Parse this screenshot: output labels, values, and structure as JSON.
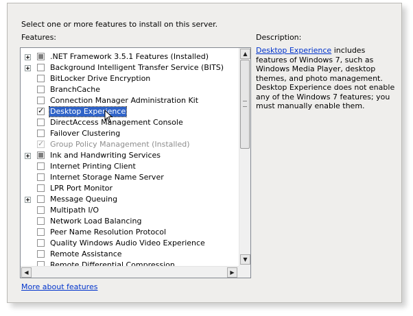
{
  "intro_text": "Select one or more features to install on this server.",
  "features_label": "Features:",
  "description_label": "Description:",
  "features": [
    {
      "label": ".NET Framework 3.5.1 Features  (Installed)",
      "expandable": true,
      "state": "partial",
      "disabled": false,
      "selected": false
    },
    {
      "label": "Background Intelligent Transfer Service (BITS)",
      "expandable": true,
      "state": "unchecked",
      "disabled": false,
      "selected": false
    },
    {
      "label": "BitLocker Drive Encryption",
      "expandable": false,
      "state": "unchecked",
      "disabled": false,
      "selected": false
    },
    {
      "label": "BranchCache",
      "expandable": false,
      "state": "unchecked",
      "disabled": false,
      "selected": false
    },
    {
      "label": "Connection Manager Administration Kit",
      "expandable": false,
      "state": "unchecked",
      "disabled": false,
      "selected": false
    },
    {
      "label": "Desktop Experience",
      "expandable": false,
      "state": "checked",
      "disabled": false,
      "selected": true
    },
    {
      "label": "DirectAccess Management Console",
      "expandable": false,
      "state": "unchecked",
      "disabled": false,
      "selected": false
    },
    {
      "label": "Failover Clustering",
      "expandable": false,
      "state": "unchecked",
      "disabled": false,
      "selected": false
    },
    {
      "label": "Group Policy Management  (Installed)",
      "expandable": false,
      "state": "checked",
      "disabled": true,
      "selected": false
    },
    {
      "label": "Ink and Handwriting Services",
      "expandable": true,
      "state": "partial",
      "disabled": false,
      "selected": false
    },
    {
      "label": "Internet Printing Client",
      "expandable": false,
      "state": "unchecked",
      "disabled": false,
      "selected": false
    },
    {
      "label": "Internet Storage Name Server",
      "expandable": false,
      "state": "unchecked",
      "disabled": false,
      "selected": false
    },
    {
      "label": "LPR Port Monitor",
      "expandable": false,
      "state": "unchecked",
      "disabled": false,
      "selected": false
    },
    {
      "label": "Message Queuing",
      "expandable": true,
      "state": "unchecked",
      "disabled": false,
      "selected": false
    },
    {
      "label": "Multipath I/O",
      "expandable": false,
      "state": "unchecked",
      "disabled": false,
      "selected": false
    },
    {
      "label": "Network Load Balancing",
      "expandable": false,
      "state": "unchecked",
      "disabled": false,
      "selected": false
    },
    {
      "label": "Peer Name Resolution Protocol",
      "expandable": false,
      "state": "unchecked",
      "disabled": false,
      "selected": false
    },
    {
      "label": "Quality Windows Audio Video Experience",
      "expandable": false,
      "state": "unchecked",
      "disabled": false,
      "selected": false
    },
    {
      "label": "Remote Assistance",
      "expandable": false,
      "state": "unchecked",
      "disabled": false,
      "selected": false
    },
    {
      "label": "Remote Differential Compression",
      "expandable": false,
      "state": "unchecked",
      "disabled": false,
      "selected": false
    }
  ],
  "description": {
    "link": "Desktop Experience",
    "text": " includes features of Windows 7, such as Windows Media Player, desktop themes, and photo management. Desktop Experience does not enable any of the Windows 7 features; you must manually enable them."
  },
  "more_link": "More about features",
  "scroll_icons": {
    "up": "▲",
    "down": "▼",
    "left": "◀",
    "right": "▶"
  },
  "colors": {
    "selection": "#2f63c8",
    "link": "#0033cc"
  }
}
